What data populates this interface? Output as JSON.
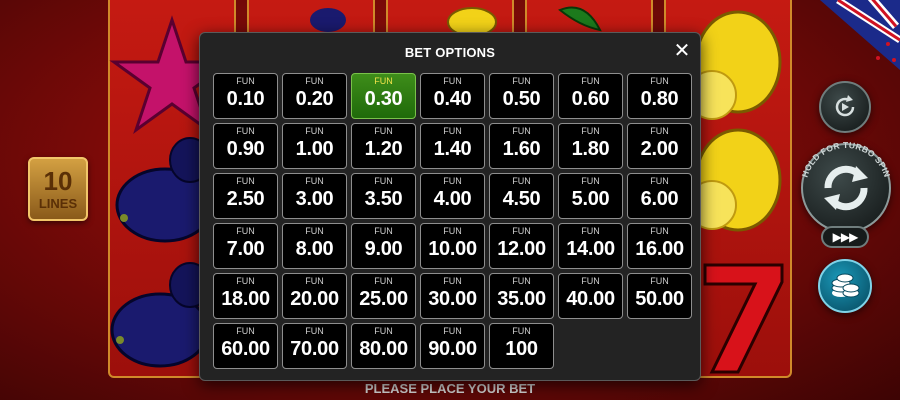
{
  "game": {
    "lines_count": "10",
    "lines_label": "LINES",
    "status_message": "PLEASE PLACE YOUR BET",
    "turbo_hint": "HOLD FOR TURBO SPIN",
    "fast_label": "▶▶▶"
  },
  "modal": {
    "title": "BET OPTIONS",
    "close_symbol": "✕",
    "selected_value": "0.30",
    "options": [
      {
        "currency": "FUN",
        "value": "0.10"
      },
      {
        "currency": "FUN",
        "value": "0.20"
      },
      {
        "currency": "FUN",
        "value": "0.30"
      },
      {
        "currency": "FUN",
        "value": "0.40"
      },
      {
        "currency": "FUN",
        "value": "0.50"
      },
      {
        "currency": "FUN",
        "value": "0.60"
      },
      {
        "currency": "FUN",
        "value": "0.80"
      },
      {
        "currency": "FUN",
        "value": "0.90"
      },
      {
        "currency": "FUN",
        "value": "1.00"
      },
      {
        "currency": "FUN",
        "value": "1.20"
      },
      {
        "currency": "FUN",
        "value": "1.40"
      },
      {
        "currency": "FUN",
        "value": "1.60"
      },
      {
        "currency": "FUN",
        "value": "1.80"
      },
      {
        "currency": "FUN",
        "value": "2.00"
      },
      {
        "currency": "FUN",
        "value": "2.50"
      },
      {
        "currency": "FUN",
        "value": "3.00"
      },
      {
        "currency": "FUN",
        "value": "3.50"
      },
      {
        "currency": "FUN",
        "value": "4.00"
      },
      {
        "currency": "FUN",
        "value": "4.50"
      },
      {
        "currency": "FUN",
        "value": "5.00"
      },
      {
        "currency": "FUN",
        "value": "6.00"
      },
      {
        "currency": "FUN",
        "value": "7.00"
      },
      {
        "currency": "FUN",
        "value": "8.00"
      },
      {
        "currency": "FUN",
        "value": "9.00"
      },
      {
        "currency": "FUN",
        "value": "10.00"
      },
      {
        "currency": "FUN",
        "value": "12.00"
      },
      {
        "currency": "FUN",
        "value": "14.00"
      },
      {
        "currency": "FUN",
        "value": "16.00"
      },
      {
        "currency": "FUN",
        "value": "18.00"
      },
      {
        "currency": "FUN",
        "value": "20.00"
      },
      {
        "currency": "FUN",
        "value": "25.00"
      },
      {
        "currency": "FUN",
        "value": "30.00"
      },
      {
        "currency": "FUN",
        "value": "35.00"
      },
      {
        "currency": "FUN",
        "value": "40.00"
      },
      {
        "currency": "FUN",
        "value": "50.00"
      },
      {
        "currency": "FUN",
        "value": "60.00"
      },
      {
        "currency": "FUN",
        "value": "70.00"
      },
      {
        "currency": "FUN",
        "value": "80.00"
      },
      {
        "currency": "FUN",
        "value": "90.00"
      },
      {
        "currency": "FUN",
        "value": "100"
      }
    ]
  },
  "colors": {
    "selected_bg": "#2e7d12",
    "selected_currency": "#f2e34a",
    "background_red": "#8a0d09"
  },
  "icons": {
    "close": "close-icon",
    "autoplay": "autoplay-icon",
    "spin": "spin-icon",
    "coins": "coins-icon",
    "flag": "flag-icon"
  }
}
